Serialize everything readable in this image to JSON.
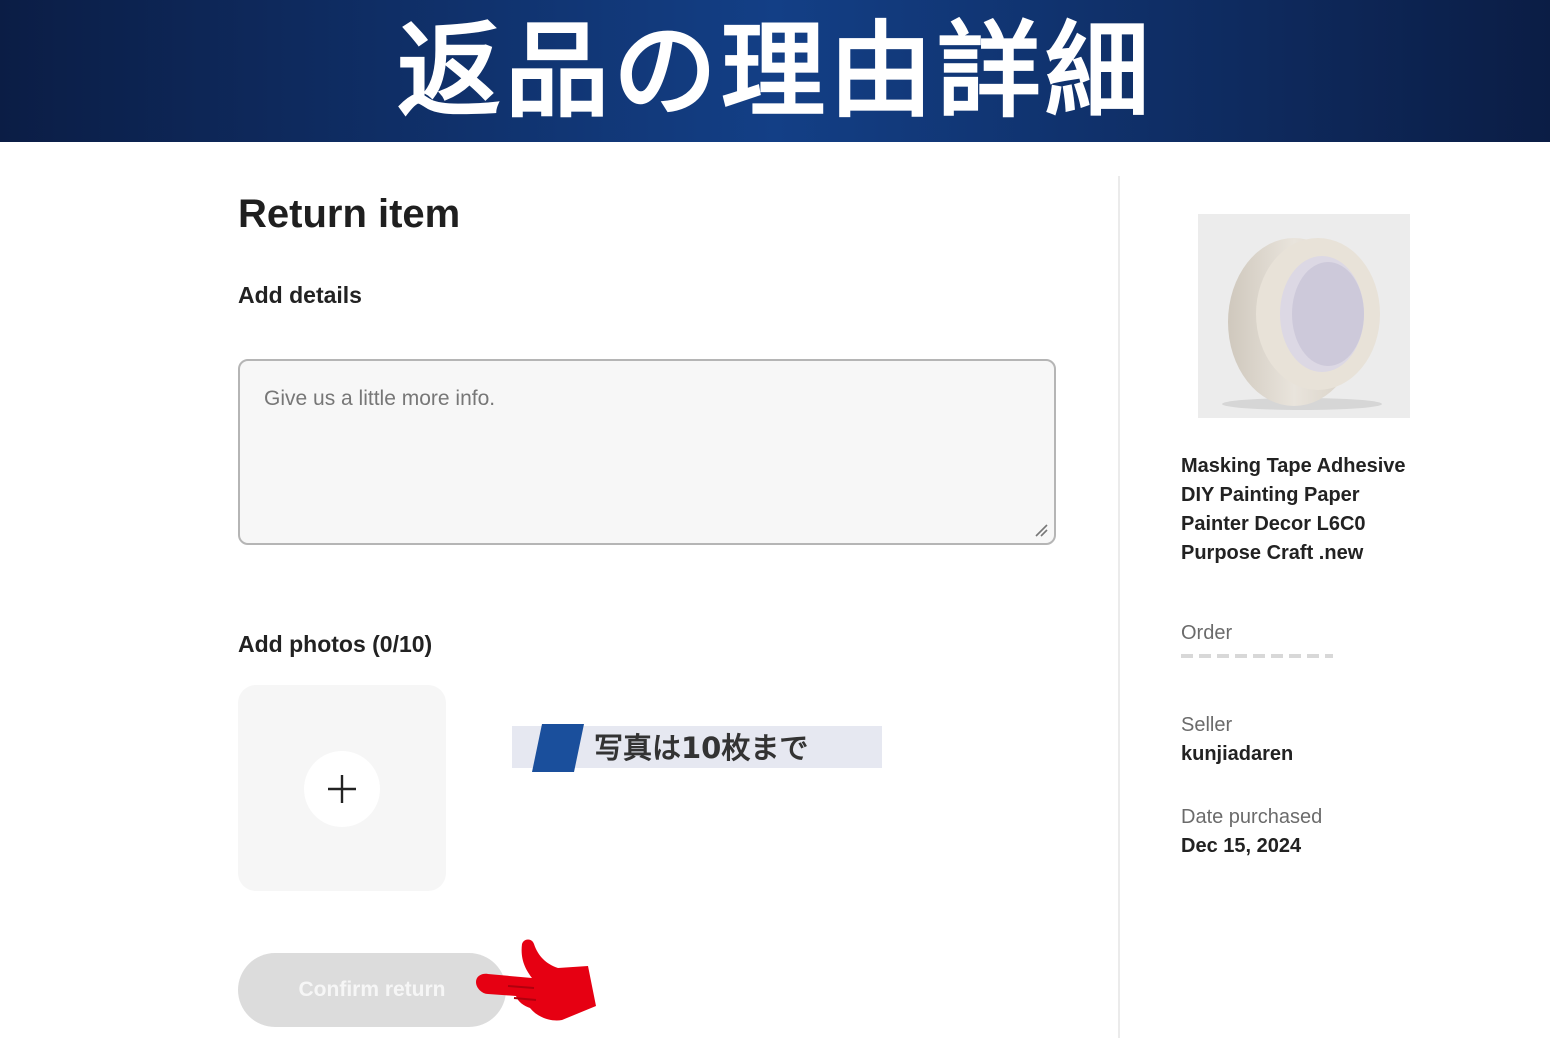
{
  "banner": {
    "title": "返品の理由詳細"
  },
  "form": {
    "title": "Return item",
    "details_label": "Add details",
    "details_placeholder": "Give us a little more info.",
    "details_value": "",
    "photos_label": "Add photos (0/10)",
    "add_photo_symbol": "+",
    "confirm_label": "Confirm return"
  },
  "annotation": {
    "note": "写真は10枚まで"
  },
  "product": {
    "title": "Masking Tape Adhesive DIY Painting Paper Painter Decor L6C0 Purpose Craft .new",
    "order_label": "Order",
    "seller_label": "Seller",
    "seller_value": "kunjiadaren",
    "date_label": "Date purchased",
    "date_value": "Dec 15, 2024"
  },
  "colors": {
    "banner": "#133f86",
    "pointer": "#e60012",
    "note_mark": "#1a4f9c",
    "button_disabled": "#dcdcdc"
  },
  "icons": {
    "add_photo": "plus-icon",
    "resize": "resize-handle-icon",
    "pointer": "pointing-hand-icon"
  }
}
